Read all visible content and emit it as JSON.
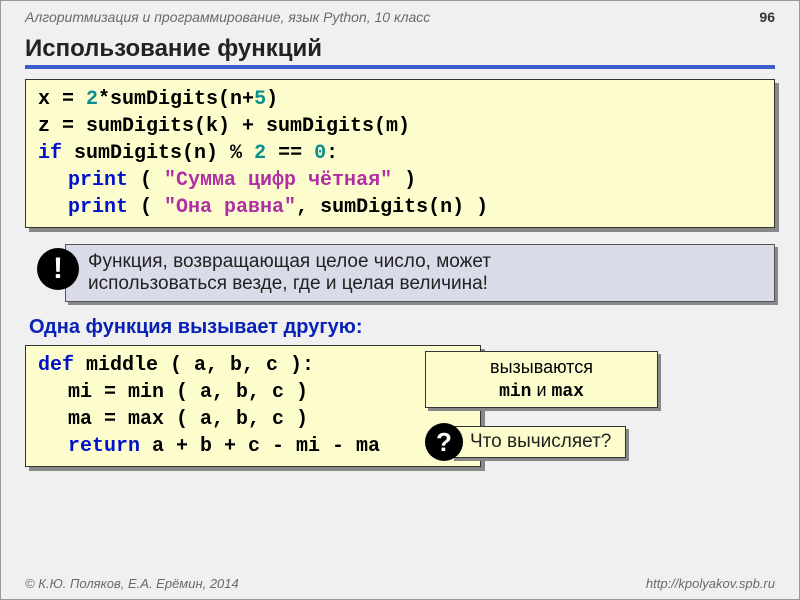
{
  "header": {
    "subject": "Алгоритмизация и программирование, язык Python, 10 класс",
    "page_number": "96"
  },
  "title": "Использование функций",
  "code1": {
    "l1a": "x = ",
    "l1b": "2",
    "l1c": "*sumDigits(n+",
    "l1d": "5",
    "l1e": ")",
    "l2": "z = sumDigits(k) + sumDigits(m)",
    "l3a": "if",
    "l3b": " sumDigits(n)",
    "l3c": " % ",
    "l3d": "2",
    "l3e": " == ",
    "l3f": "0",
    "l3g": ":",
    "l4a": "print",
    "l4b": " ( ",
    "l4c": "\"Сумма цифр чётная\"",
    "l4d": " )",
    "l5a": "print",
    "l5b": " ( ",
    "l5c": "\"Она равна\"",
    "l5d": ", sumDigits(n) )"
  },
  "callout": {
    "bang": "!",
    "text1": "Функция, возвращающая целое число, может",
    "text2": "использоваться везде, где и целая величина!"
  },
  "subhead": "Одна функция вызывает другую:",
  "code2": {
    "l1a": "def",
    "l1b": " middle ( a, b, c ):",
    "l2": "mi = min ( a, b, c )",
    "l3": "ma = max ( a, b, c )",
    "l4a": "return",
    "l4b": " a + b + c - mi - ma"
  },
  "sidenote": {
    "line1": "вызываются",
    "min": "min",
    "and": " и ",
    "max": "max"
  },
  "question": {
    "mark": "?",
    "text": "Что вычисляет?"
  },
  "footer": {
    "left": "© К.Ю. Поляков, Е.А. Ерёмин, 2014",
    "right": "http://kpolyakov.spb.ru"
  }
}
